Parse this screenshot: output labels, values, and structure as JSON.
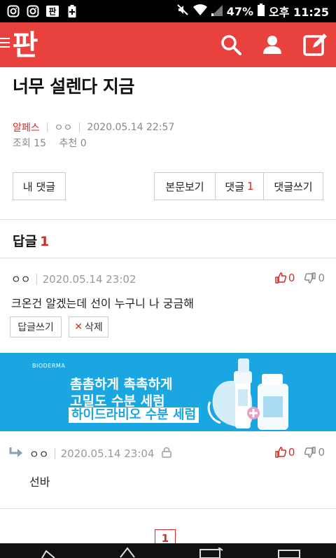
{
  "status_bar": {
    "battery_percent": "47%",
    "time": "오후 11:25",
    "left_icons": [
      "instagram-icon",
      "instagram-icon",
      "pann-notification-icon",
      "battery-saver-icon"
    ],
    "right_icons": [
      "mute-icon",
      "wifi-icon",
      "signal-icon",
      "battery-icon"
    ]
  },
  "header": {
    "logo_text": "판",
    "icons": [
      "menu-icon",
      "search-icon",
      "user-icon",
      "write-icon"
    ],
    "accent_color": "#e8413e"
  },
  "post": {
    "title": "너무 설렌다 지금",
    "author": "알페스",
    "author_sub": "ㅇㅇ",
    "date": "2020.05.14 22:57",
    "views_label": "조회 15",
    "recommend_label": "추천 0"
  },
  "actions": {
    "my_comments": "내 댓글",
    "view_body": "본문보기",
    "comments_label": "댓글",
    "comments_count": "1",
    "write_comment": "댓글쓰기"
  },
  "replies": {
    "label": "답글",
    "count": "1"
  },
  "comments": [
    {
      "author": "ㅇㅇ",
      "date": "2020.05.14 23:02",
      "up": "0",
      "down": "0",
      "text": "크온건 알겠는데 선이 누구니 나 궁금해",
      "reply_button": "답글쓰기",
      "delete_button": "삭제"
    },
    {
      "author": "ㅇㅇ",
      "date": "2020.05.14 23:04",
      "up": "0",
      "down": "0",
      "text": "선바"
    }
  ],
  "ad": {
    "brand": "BIODERMA",
    "line1": "촘촘하게 촉촉하게",
    "line2": "고밀도 수분 세럼",
    "line3": "하이드라비오 수분 세럼",
    "bg_color": "#1aa7e1"
  },
  "pagination": {
    "current": "1"
  }
}
